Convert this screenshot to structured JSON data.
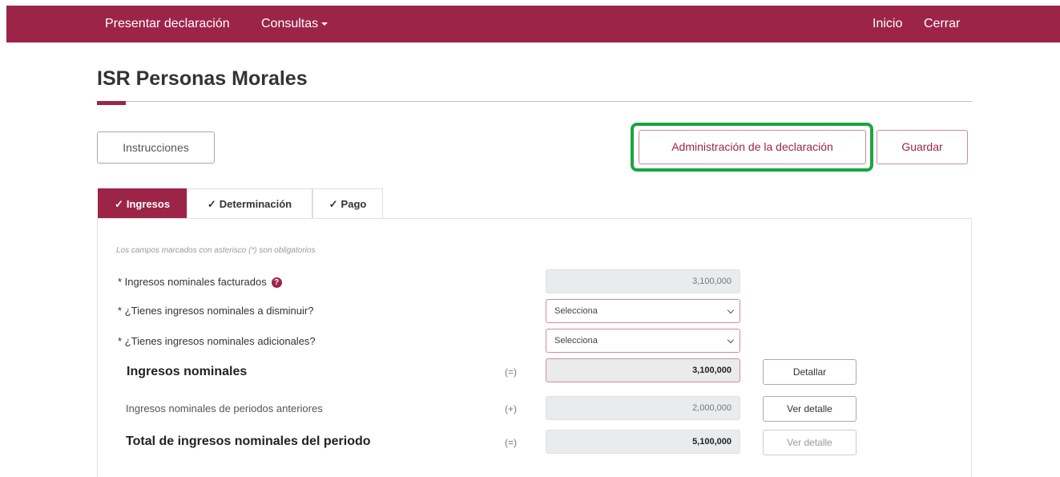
{
  "navbar": {
    "presentar": "Presentar declaración",
    "consultas": "Consultas",
    "inicio": "Inicio",
    "cerrar": "Cerrar"
  },
  "page": {
    "title": "ISR Personas Morales"
  },
  "toolbar": {
    "instrucciones": "Instrucciones",
    "administracion": "Administración de la declaración",
    "guardar": "Guardar"
  },
  "tabs": [
    {
      "label": "Ingresos",
      "active": true
    },
    {
      "label": "Determinación",
      "active": false
    },
    {
      "label": "Pago",
      "active": false
    }
  ],
  "form": {
    "note": "Los campos marcados con asterisco (*) son obligatorios",
    "rows": [
      {
        "label": "* Ingresos nominales facturados",
        "value": "3,100,000"
      },
      {
        "label": "* ¿Tienes ingresos nominales a disminuir?",
        "value": "Selecciona"
      },
      {
        "label": "* ¿Tienes ingresos nominales adicionales?",
        "value": "Selecciona"
      },
      {
        "label": "Ingresos nominales",
        "sign": "(=)",
        "value": "3,100,000",
        "action": "Detallar"
      },
      {
        "label": "Ingresos nominales de periodos anteriores",
        "sign": "(+)",
        "value": "2,000,000",
        "action": "Ver detalle"
      },
      {
        "label": "Total de ingresos nominales del periodo",
        "sign": "(=)",
        "value": "5,100,000",
        "action": "Ver detalle"
      }
    ]
  },
  "icons": {
    "help": "question-circle-icon",
    "check": "check-icon",
    "caret": "caret-down-icon",
    "chevron": "chevron-down-icon"
  },
  "colors": {
    "primary": "#9d2449",
    "highlight": "#1aa63f"
  }
}
